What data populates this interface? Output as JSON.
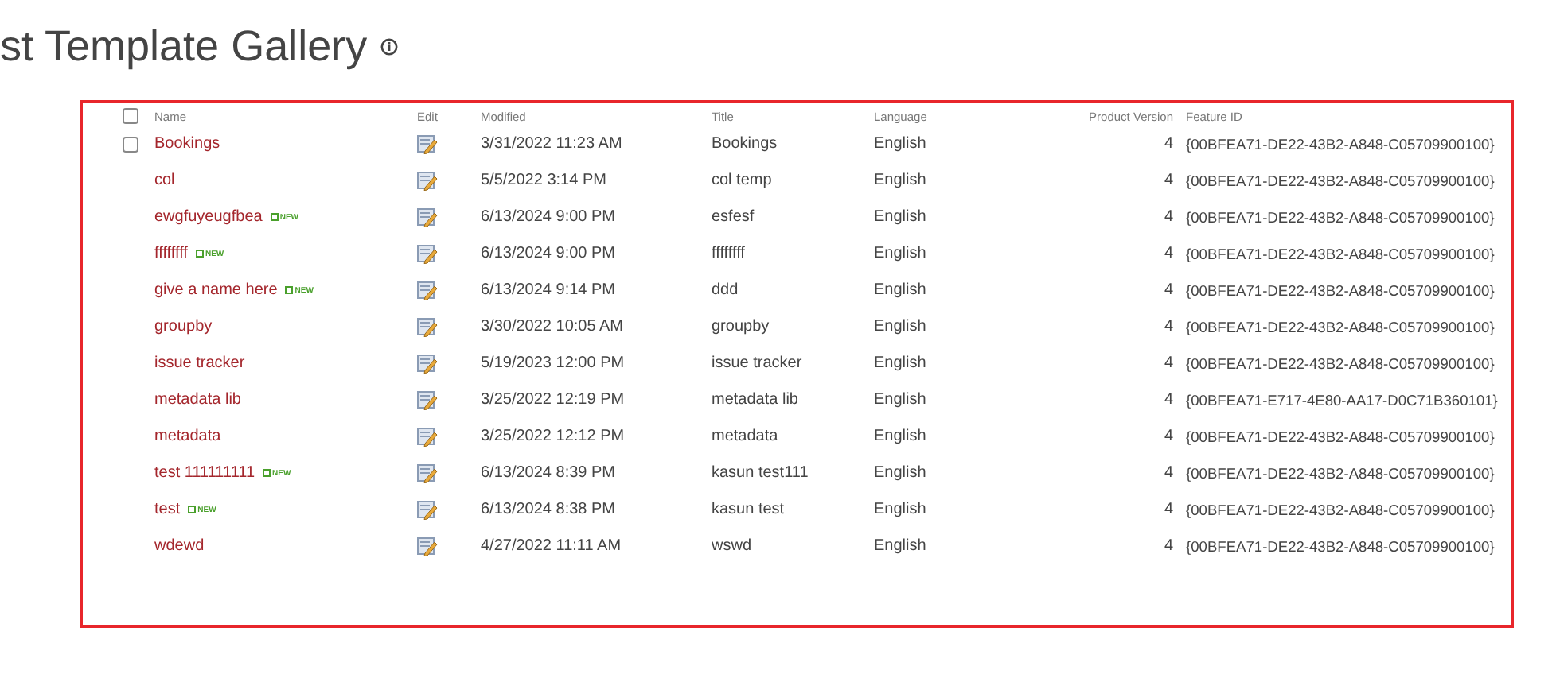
{
  "page_title": "st Template Gallery",
  "table": {
    "select_all": {
      "checked": false
    },
    "columns": [
      "Name",
      "Edit",
      "Modified",
      "Title",
      "Language",
      "Product Version",
      "Feature ID"
    ],
    "rows": [
      {
        "name": "Bookings",
        "hovered": true,
        "checked": false,
        "modified": "3/31/2022 11:23 AM",
        "title": "Bookings",
        "language": "English",
        "version": "4",
        "feature_id": "{00BFEA71-DE22-43B2-A848-C05709900100}"
      },
      {
        "name": "col",
        "hovered": false,
        "checked": false,
        "modified": "5/5/2022 3:14 PM",
        "title": "col temp",
        "language": "English",
        "version": "4",
        "feature_id": "{00BFEA71-DE22-43B2-A848-C05709900100}"
      },
      {
        "name": "ewgfuyeugfbea",
        "badge": "NEW",
        "hovered": false,
        "checked": false,
        "modified": "6/13/2024 9:00 PM",
        "title": "esfesf",
        "language": "English",
        "version": "4",
        "feature_id": "{00BFEA71-DE22-43B2-A848-C05709900100}"
      },
      {
        "name": "ffffffff",
        "badge": "NEW",
        "hovered": false,
        "checked": false,
        "modified": "6/13/2024 9:00 PM",
        "title": "ffffffff",
        "language": "English",
        "version": "4",
        "feature_id": "{00BFEA71-DE22-43B2-A848-C05709900100}"
      },
      {
        "name": "give a name here",
        "badge": "NEW",
        "hovered": false,
        "checked": false,
        "modified": "6/13/2024 9:14 PM",
        "title": "ddd",
        "language": "English",
        "version": "4",
        "feature_id": "{00BFEA71-DE22-43B2-A848-C05709900100}"
      },
      {
        "name": "groupby",
        "hovered": false,
        "checked": false,
        "modified": "3/30/2022 10:05 AM",
        "title": "groupby",
        "language": "English",
        "version": "4",
        "feature_id": "{00BFEA71-DE22-43B2-A848-C05709900100}"
      },
      {
        "name": "issue tracker",
        "hovered": false,
        "checked": false,
        "modified": "5/19/2023 12:00 PM",
        "title": "issue tracker",
        "language": "English",
        "version": "4",
        "feature_id": "{00BFEA71-DE22-43B2-A848-C05709900100}"
      },
      {
        "name": "metadata lib",
        "hovered": false,
        "checked": false,
        "modified": "3/25/2022 12:19 PM",
        "title": "metadata lib",
        "language": "English",
        "version": "4",
        "feature_id": "{00BFEA71-E717-4E80-AA17-D0C71B360101}"
      },
      {
        "name": "metadata",
        "hovered": false,
        "checked": false,
        "modified": "3/25/2022 12:12 PM",
        "title": "metadata",
        "language": "English",
        "version": "4",
        "feature_id": "{00BFEA71-DE22-43B2-A848-C05709900100}"
      },
      {
        "name": "test 111111111",
        "badge": "NEW",
        "hovered": false,
        "checked": false,
        "modified": "6/13/2024 8:39 PM",
        "title": "kasun test111",
        "language": "English",
        "version": "4",
        "feature_id": "{00BFEA71-DE22-43B2-A848-C05709900100}"
      },
      {
        "name": "test",
        "badge": "NEW",
        "hovered": false,
        "checked": false,
        "modified": "6/13/2024 8:38 PM",
        "title": "kasun test",
        "language": "English",
        "version": "4",
        "feature_id": "{00BFEA71-DE22-43B2-A848-C05709900100}"
      },
      {
        "name": "wdewd",
        "hovered": false,
        "checked": false,
        "modified": "4/27/2022 11:11 AM",
        "title": "wswd",
        "language": "English",
        "version": "4",
        "feature_id": "{00BFEA71-DE22-43B2-A848-C05709900100}"
      }
    ]
  }
}
